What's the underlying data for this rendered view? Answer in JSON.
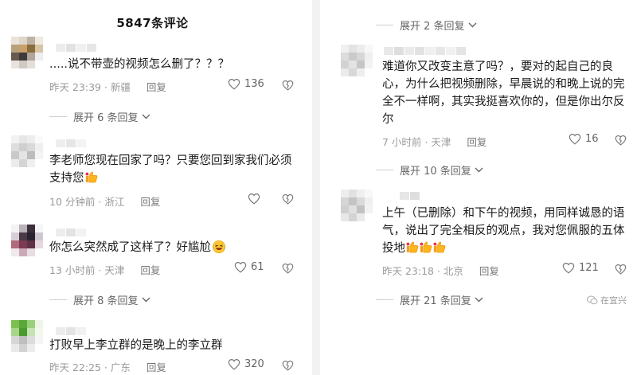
{
  "header": {
    "title": "5847条评论"
  },
  "left_comments": [
    {
      "text": ".....说不带壶的视频怎么删了？？？",
      "time": "昨天 23:39",
      "location": "新疆",
      "reply": "回复",
      "likes": "136"
    },
    {
      "text": "李老师您现在回家了吗？只要您回到家我们必须支持您",
      "time": "10 分钟前",
      "location": "浙江",
      "reply": "回复",
      "likes": ""
    },
    {
      "text": "你怎么突然成了这样了？好尴尬",
      "time": "13 小时前",
      "location": "天津",
      "reply": "回复",
      "likes": "61"
    },
    {
      "text": "打败早上李立群的是晚上的李立群",
      "time": "昨天 22:25",
      "location": "广东",
      "reply": "回复",
      "likes": "320"
    }
  ],
  "left_expands": [
    "展开 6 条回复",
    "展开 8 条回复"
  ],
  "right_comments": [
    {
      "text": "难道你又改变主意了吗？，要对的起自己的良心，为什么把视频删除，早晨说的和晚上说的完全不一样啊，其实我挺喜欢你的，但是你出尔反尔",
      "time": "7 小时前",
      "location": "天津",
      "reply": "回复",
      "likes": "16"
    },
    {
      "text": "上午（已删除）和下午的视频，用同样诚恳的语气，说出了完全相反的观点，我对您佩服的五体投地",
      "time": "昨天 23:18",
      "location": "北京",
      "reply": "回复",
      "likes": "121"
    }
  ],
  "right_expands": [
    "展开 2 条回复",
    "展开 10 条回复",
    "展开 21 条回复"
  ],
  "watermark": "在宜兴",
  "icons": {
    "like": "heart-outline-icon",
    "dislike": "broken-heart-icon",
    "expand": "chevron-down-icon",
    "thumbs": "thumbs-up-emoji",
    "laugh": "laughing-emoji"
  }
}
